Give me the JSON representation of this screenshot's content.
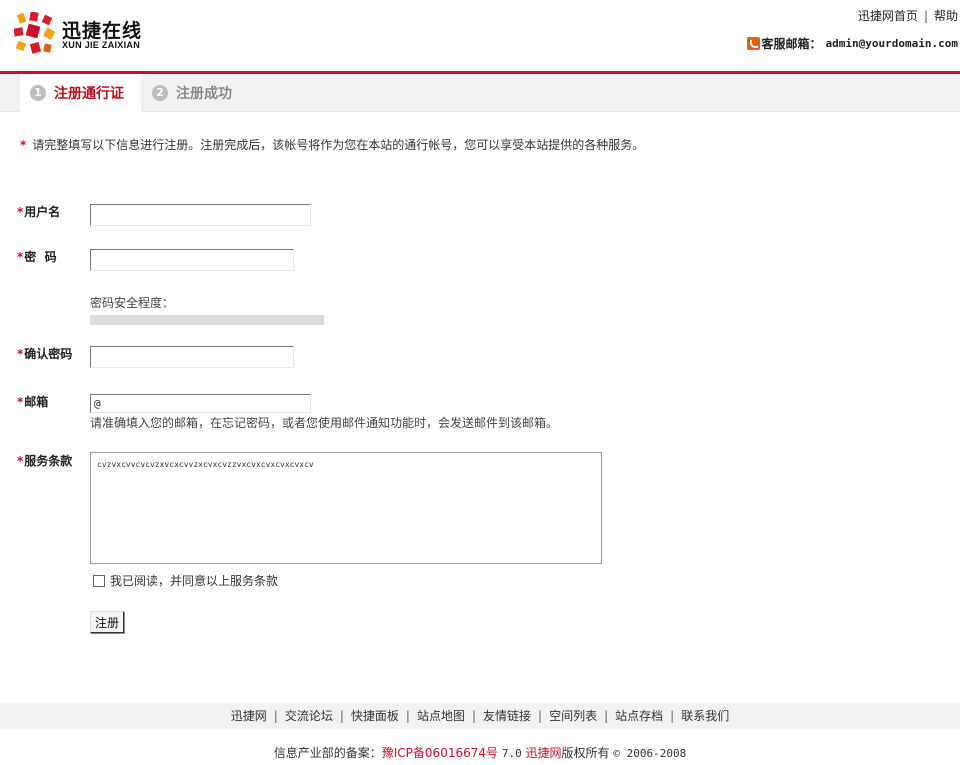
{
  "header": {
    "logo_cn": "迅捷在线",
    "logo_en": "XUN JIE ZAIXIAN",
    "top_links": [
      "迅捷网首页",
      "帮助"
    ],
    "service_label": "客服邮箱：",
    "service_email": "admin@yourdomain.com"
  },
  "steps": [
    {
      "num": "1",
      "label": "注册通行证",
      "active": true
    },
    {
      "num": "2",
      "label": "注册成功",
      "active": false
    }
  ],
  "intro": {
    "star": "*",
    "text": "请完整填写以下信息进行注册。注册完成后，该帐号将作为您在本站的通行帐号，您可以享受本站提供的各种服务。"
  },
  "form": {
    "star": "*",
    "username_label": "用户名",
    "username_value": "",
    "password_label": "密  码",
    "password_value": "",
    "strength_label": "密码安全程度：",
    "confirm_label": "确认密码",
    "confirm_value": "",
    "email_label": "邮箱",
    "email_value": "@",
    "email_hint": "请准确填入您的邮箱，在忘记密码，或者您使用邮件通知功能时，会发送邮件到该邮箱。",
    "terms_label": "服务条款",
    "terms_text": "cvzvxcvvcvcvzxvcxcvvzxcvxcvzzvxcvxcvxcvxcvxcv",
    "agree_label": "我已阅读，并同意以上服务条款",
    "agree_checked": false,
    "submit_label": "注册"
  },
  "footer": {
    "links": [
      "迅捷网",
      "交流论坛",
      "快捷面板",
      "站点地图",
      "友情链接",
      "空间列表",
      "站点存档",
      "联系我们"
    ],
    "icp_prefix": "信息产业部的备案：",
    "icp_number": "豫ICP备06016674号",
    "version": "7.0",
    "brand": "迅捷网",
    "rights": "版权所有",
    "copy": "© 2006-2008"
  },
  "colors": {
    "accent_red": "#c8102e",
    "step_bar_bg": "#f2f2f2"
  }
}
